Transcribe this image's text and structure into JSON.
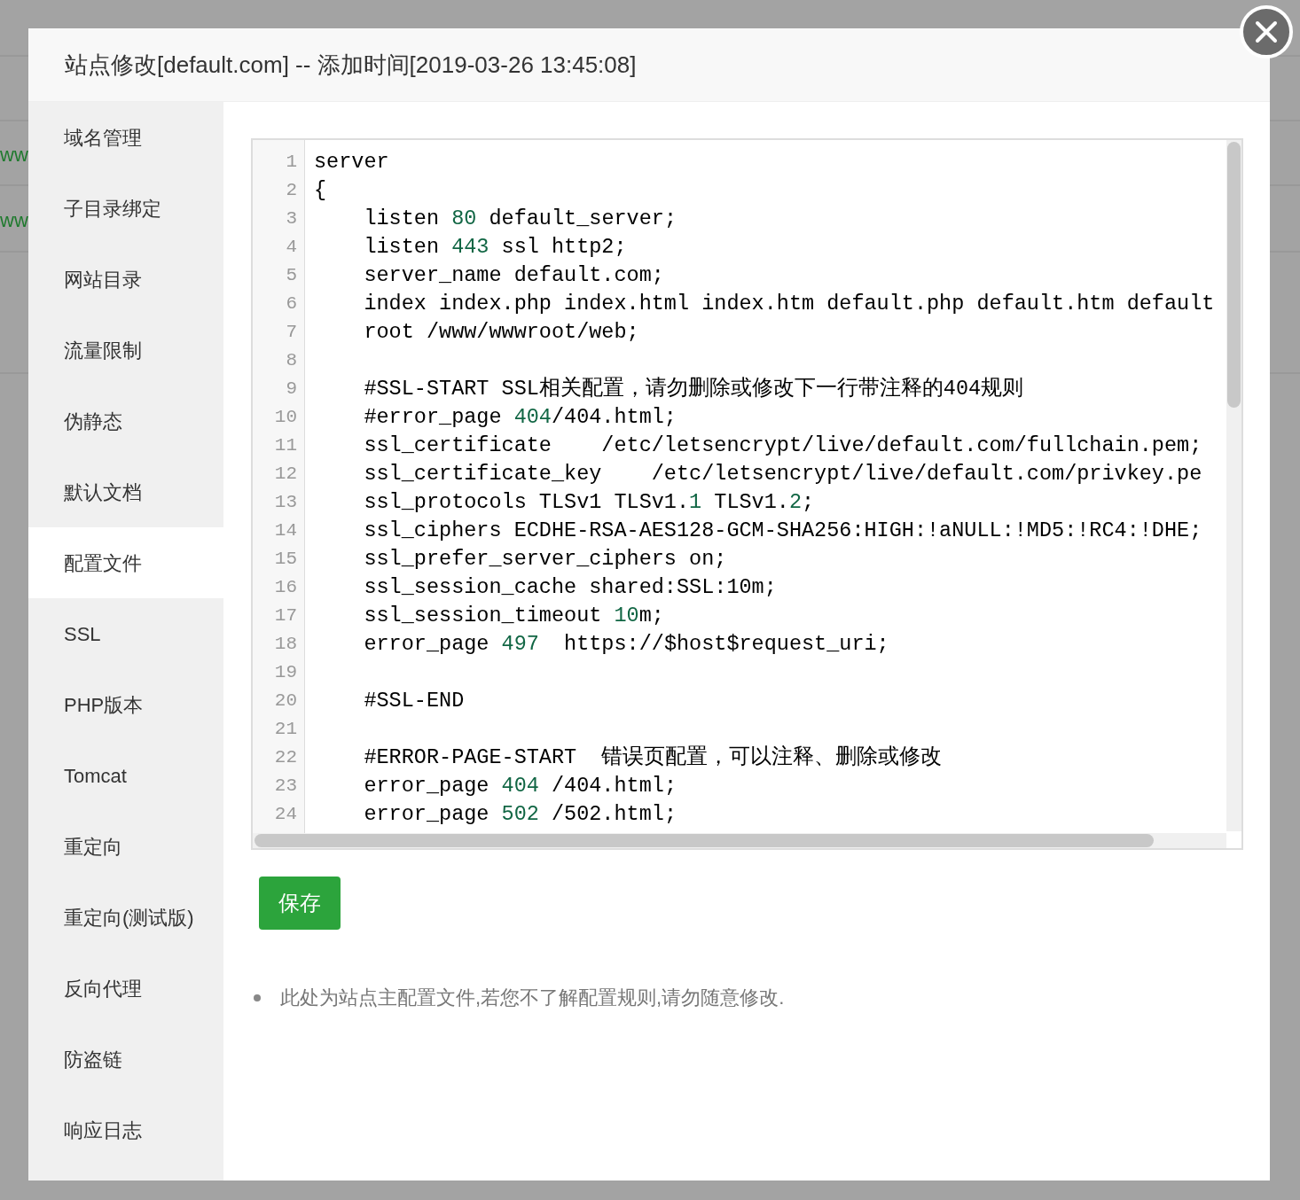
{
  "background_rows": [
    {
      "text": "ww"
    },
    {
      "text": "ww"
    }
  ],
  "dialog": {
    "title": "站点修改[default.com] -- 添加时间[2019-03-26 13:45:08]"
  },
  "sidebar": {
    "items": [
      {
        "label": "域名管理",
        "selected": false
      },
      {
        "label": "子目录绑定",
        "selected": false
      },
      {
        "label": "网站目录",
        "selected": false
      },
      {
        "label": "流量限制",
        "selected": false
      },
      {
        "label": "伪静态",
        "selected": false
      },
      {
        "label": "默认文档",
        "selected": false
      },
      {
        "label": "配置文件",
        "selected": true
      },
      {
        "label": "SSL",
        "selected": false
      },
      {
        "label": "PHP版本",
        "selected": false
      },
      {
        "label": "Tomcat",
        "selected": false
      },
      {
        "label": "重定向",
        "selected": false
      },
      {
        "label": "重定向(测试版)",
        "selected": false
      },
      {
        "label": "反向代理",
        "selected": false
      },
      {
        "label": "防盗链",
        "selected": false
      },
      {
        "label": "响应日志",
        "selected": false
      }
    ]
  },
  "editor": {
    "lines": [
      {
        "number": "1",
        "tokens": [
          {
            "kind": "text",
            "text": "server"
          }
        ]
      },
      {
        "number": "2",
        "tokens": [
          {
            "kind": "text",
            "text": "{"
          }
        ]
      },
      {
        "number": "3",
        "tokens": [
          {
            "kind": "text",
            "text": "    listen "
          },
          {
            "kind": "number",
            "text": "80"
          },
          {
            "kind": "text",
            "text": " default_server;"
          }
        ]
      },
      {
        "number": "4",
        "tokens": [
          {
            "kind": "text",
            "text": "    listen "
          },
          {
            "kind": "number",
            "text": "443"
          },
          {
            "kind": "text",
            "text": " ssl http2;"
          }
        ]
      },
      {
        "number": "5",
        "tokens": [
          {
            "kind": "text",
            "text": "    server_name default.com;"
          }
        ]
      },
      {
        "number": "6",
        "tokens": [
          {
            "kind": "text",
            "text": "    index index.php index.html index.htm default.php default.htm default"
          }
        ]
      },
      {
        "number": "7",
        "tokens": [
          {
            "kind": "text",
            "text": "    root /www/wwwroot/web;"
          }
        ]
      },
      {
        "number": "8"
      },
      {
        "number": "9",
        "tokens": [
          {
            "kind": "text",
            "text": "    #SSL-START SSL相关配置，请勿删除或修改下一行带注释的404规则"
          }
        ]
      },
      {
        "number": "10",
        "tokens": [
          {
            "kind": "text",
            "text": "    #error_page "
          },
          {
            "kind": "number",
            "text": "404"
          },
          {
            "kind": "text",
            "text": "/404.html;"
          }
        ]
      },
      {
        "number": "11",
        "tokens": [
          {
            "kind": "text",
            "text": "    ssl_certificate    /etc/letsencrypt/live/default.com/fullchain.pem;"
          }
        ]
      },
      {
        "number": "12",
        "tokens": [
          {
            "kind": "text",
            "text": "    ssl_certificate_key    /etc/letsencrypt/live/default.com/privkey.pe"
          }
        ]
      },
      {
        "number": "13",
        "tokens": [
          {
            "kind": "text",
            "text": "    ssl_protocols TLSv1 TLSv1."
          },
          {
            "kind": "number",
            "text": "1"
          },
          {
            "kind": "text",
            "text": " TLSv1."
          },
          {
            "kind": "number",
            "text": "2"
          },
          {
            "kind": "text",
            "text": ";"
          }
        ]
      },
      {
        "number": "14",
        "tokens": [
          {
            "kind": "text",
            "text": "    ssl_ciphers ECDHE-RSA-AES128-GCM-SHA256:HIGH:!aNULL:!MD5:!RC4:!DHE;"
          }
        ]
      },
      {
        "number": "15",
        "tokens": [
          {
            "kind": "text",
            "text": "    ssl_prefer_server_ciphers on;"
          }
        ]
      },
      {
        "number": "16",
        "tokens": [
          {
            "kind": "text",
            "text": "    ssl_session_cache shared:SSL:10m;"
          }
        ]
      },
      {
        "number": "17",
        "tokens": [
          {
            "kind": "text",
            "text": "    ssl_session_timeout "
          },
          {
            "kind": "number",
            "text": "10"
          },
          {
            "kind": "text",
            "text": "m;"
          }
        ]
      },
      {
        "number": "18",
        "tokens": [
          {
            "kind": "text",
            "text": "    error_page "
          },
          {
            "kind": "number",
            "text": "497"
          },
          {
            "kind": "text",
            "text": "  https://$host$request_uri;"
          }
        ]
      },
      {
        "number": "19"
      },
      {
        "number": "20",
        "tokens": [
          {
            "kind": "text",
            "text": "    #SSL-END"
          }
        ]
      },
      {
        "number": "21"
      },
      {
        "number": "22",
        "tokens": [
          {
            "kind": "text",
            "text": "    #ERROR-PAGE-START  错误页配置，可以注释、删除或修改"
          }
        ]
      },
      {
        "number": "23",
        "tokens": [
          {
            "kind": "text",
            "text": "    error_page "
          },
          {
            "kind": "number",
            "text": "404"
          },
          {
            "kind": "text",
            "text": " /404.html;"
          }
        ]
      },
      {
        "number": "24",
        "tokens": [
          {
            "kind": "text",
            "text": "    error_page "
          },
          {
            "kind": "number",
            "text": "502"
          },
          {
            "kind": "text",
            "text": " /502.html;"
          }
        ]
      }
    ]
  },
  "save_button": {
    "label": "保存"
  },
  "notes": [
    "此处为站点主配置文件,若您不了解配置规则,请勿随意修改."
  ]
}
